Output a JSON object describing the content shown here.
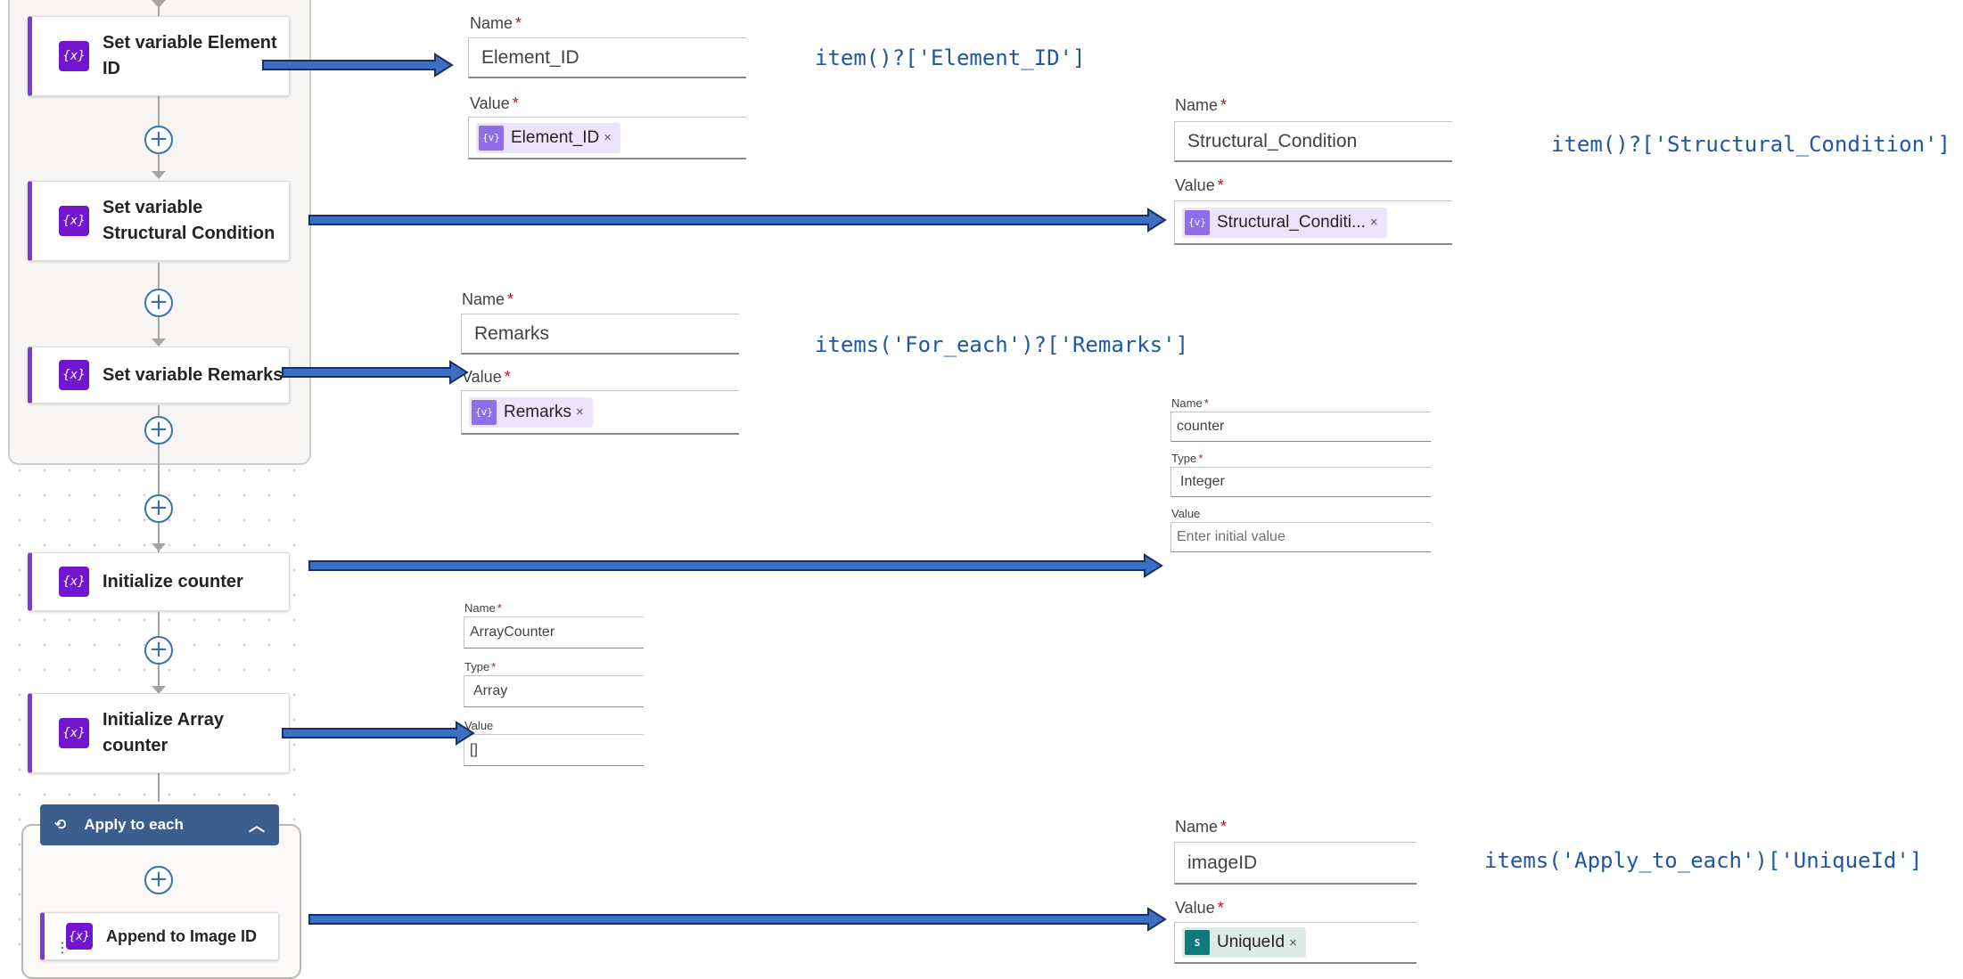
{
  "flow": {
    "steps": [
      {
        "id": "set-element-id",
        "title_line1": "Set variable Element",
        "title_line2": "ID",
        "icon": "variable-icon",
        "icon_glyph": "{x}"
      },
      {
        "id": "set-structural",
        "title_line1": "Set variable",
        "title_line2": "Structural Condition",
        "icon": "variable-icon",
        "icon_glyph": "{x}"
      },
      {
        "id": "set-remarks",
        "title_line1": "Set variable Remarks",
        "title_line2": "",
        "icon": "variable-icon",
        "icon_glyph": "{x}"
      },
      {
        "id": "init-counter",
        "title_line1": "Initialize counter",
        "title_line2": "",
        "icon": "variable-icon",
        "icon_glyph": "{x}"
      },
      {
        "id": "init-array-counter",
        "title_line1": "Initialize Array",
        "title_line2": "counter",
        "icon": "variable-icon",
        "icon_glyph": "{x}"
      },
      {
        "id": "append-image-id",
        "title_line1": "Append to Image ID",
        "title_line2": "",
        "icon": "variable-icon",
        "icon_glyph": "{x}"
      }
    ],
    "apply_to_each": {
      "label": "Apply to each",
      "icon": "loop-icon",
      "chevron": "chevron-up-icon"
    },
    "add_step_glyph": "+"
  },
  "panels": {
    "element_id": {
      "name_label": "Name",
      "value_label": "Value",
      "required_mark": "*",
      "name_value": "Element_ID",
      "token": {
        "label": "Element_ID",
        "remove": "×",
        "icon_glyph": "{v}"
      },
      "expression": "item()?['Element_ID']"
    },
    "structural": {
      "name_label": "Name",
      "value_label": "Value",
      "required_mark": "*",
      "name_value": "Structural_Condition",
      "token": {
        "label": "Structural_Conditi...",
        "remove": "×",
        "icon_glyph": "{v}"
      },
      "expression": "item()?['Structural_Condition']"
    },
    "remarks": {
      "name_label": "Name",
      "value_label": "Value",
      "required_mark": "*",
      "name_value": "Remarks",
      "token": {
        "label": "Remarks",
        "remove": "×",
        "icon_glyph": "{v}"
      },
      "expression": "items('For_each')?['Remarks']"
    },
    "counter": {
      "name_label": "Name",
      "type_label": "Type",
      "value_label": "Value",
      "required_mark": "*",
      "name_value": "counter",
      "type_value": "Integer",
      "value_placeholder": "Enter initial value"
    },
    "array_counter": {
      "name_label": "Name",
      "type_label": "Type",
      "value_label": "Value",
      "required_mark": "*",
      "name_value": "ArrayCounter",
      "type_value": "Array",
      "value_value": "[]"
    },
    "image_id": {
      "name_label": "Name",
      "value_label": "Value",
      "required_mark": "*",
      "name_value": "imageID",
      "token": {
        "label": "UniqueId",
        "remove": "×",
        "icon_glyph": "S"
      },
      "expression": "items('Apply_to_each')['UniqueId']"
    }
  },
  "colors": {
    "arrow_fill": "#3a6fc4",
    "arrow_stroke": "#1a2f63",
    "variable_purple": "#7115cf",
    "apply_header": "#3c5e8f",
    "expression_blue": "#1f56a8"
  }
}
